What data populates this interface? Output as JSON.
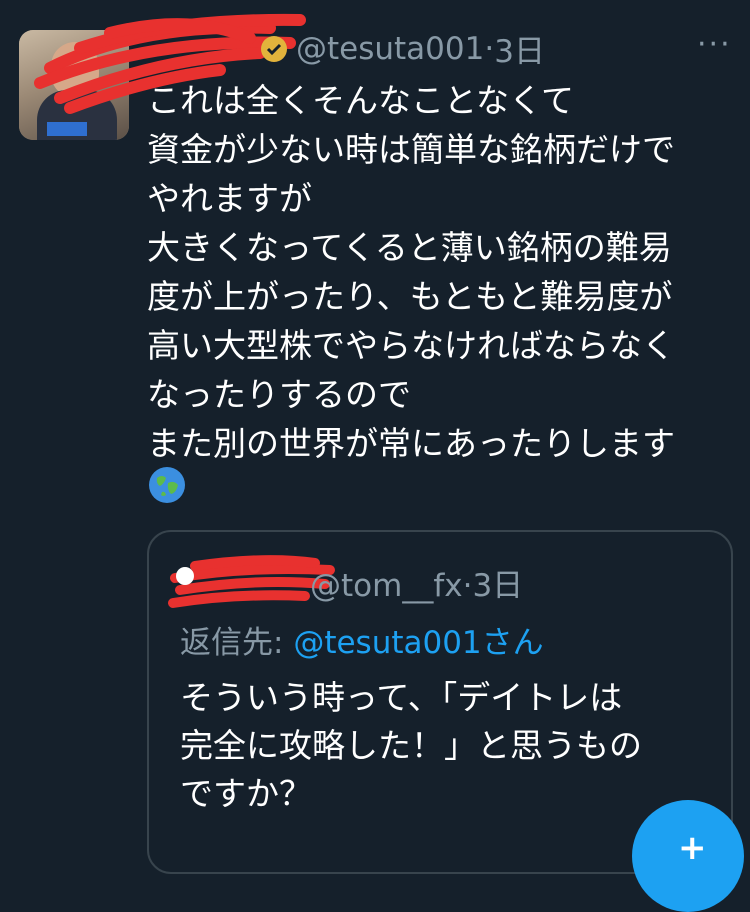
{
  "tweet": {
    "handle": "@tesuta001",
    "separator": "·",
    "time": "3日",
    "text": "これは全くそんなことなくて\n資金が少ない時は簡単な銘柄だけで\nやれますが\n大きくなってくると薄い銘柄の難易\n度が上がったり、もともと難易度が\n高い大型株でやらなければならなく\nなったりするので\nまた別の世界が常にあったりします",
    "emoji_icon": "globe-icon",
    "more_label": "···"
  },
  "quote": {
    "handle": "@tom__fx",
    "separator": "·",
    "time": "3日",
    "reply_prefix": "返信先: ",
    "reply_mention": "@tesuta001さん",
    "text": "そういう時って、「デイトレは\n完全に攻略した！」と思うもの\nですか？"
  },
  "fab": {
    "label": "+"
  },
  "colors": {
    "background": "#15202b",
    "secondary_text": "#8899a6",
    "accent": "#1da1f2",
    "border": "#38444d",
    "redaction": "#e8312f"
  }
}
